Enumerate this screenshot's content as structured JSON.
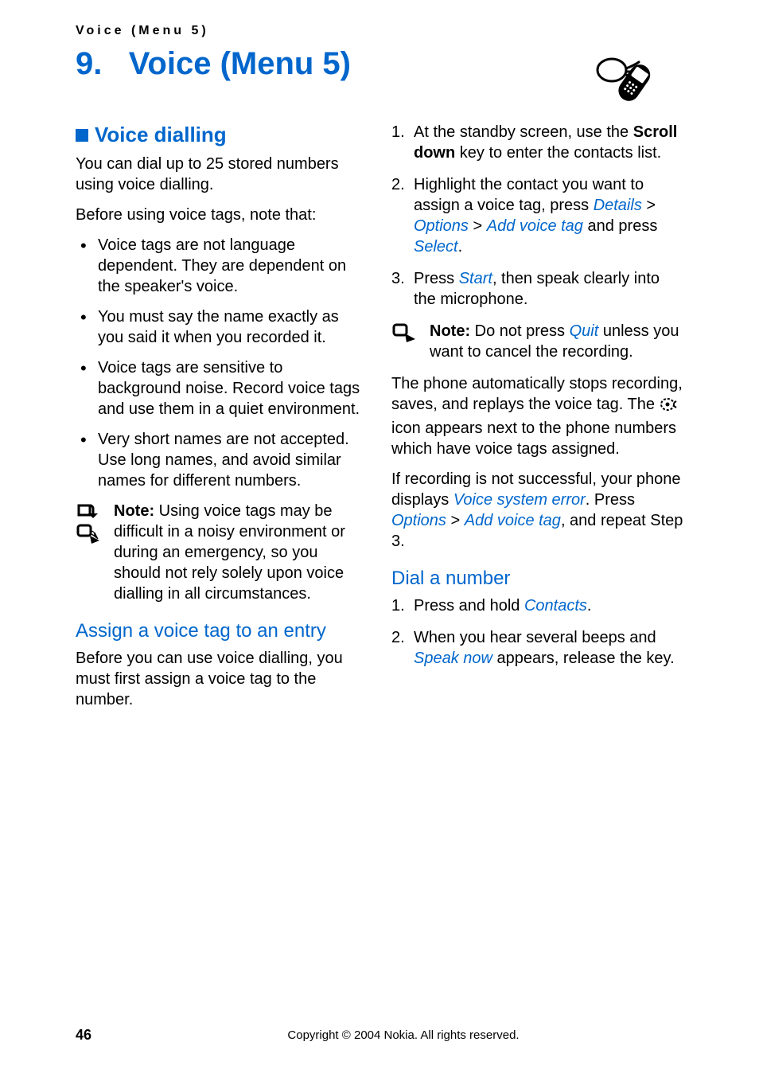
{
  "running_head": "Voice (Menu 5)",
  "chapter_number": "9.",
  "chapter_title": "Voice (Menu 5)",
  "left": {
    "section_title": "Voice dialling",
    "intro": "You can dial up to 25 stored numbers using voice dialling.",
    "before_using": "Before using voice tags, note that:",
    "bullets": [
      "Voice tags are not language dependent. They are dependent on the speaker's voice.",
      "You must say the name exactly as you said it when you recorded it.",
      "Voice tags are sensitive to background noise. Record voice tags and use them in a quiet environment.",
      "Very short names are not accepted. Use long names, and avoid similar names for different numbers."
    ],
    "note_label": "Note:",
    "note_body": " Using voice tags may be difficult in a noisy environment or during an emergency, so you should not rely solely upon voice dialling in all circumstances.",
    "assign_title": "Assign a voice tag to an entry",
    "assign_para": "Before you can use voice dialling, you must first assign a voice tag to the number."
  },
  "right": {
    "step1_a": "At the standby screen, use the ",
    "step1_b": "Scroll down",
    "step1_c": " key to enter the contacts list.",
    "step2_a": "Highlight the contact you want to assign a voice tag, press ",
    "step2_details": "Details",
    "step2_options": "Options",
    "step2_addvt": "Add voice tag",
    "step2_b": " and press ",
    "step2_select": "Select",
    "step3_a": "Press ",
    "step3_start": "Start",
    "step3_b": ", then speak clearly into the microphone.",
    "note_label": "Note:",
    "note_a": " Do not press ",
    "note_quit": "Quit",
    "note_b": " unless you want to cancel the recording.",
    "auto_a": "The phone automatically stops recording, saves, and replays the voice tag. The ",
    "auto_b": " icon appears next to the phone numbers which have voice tags assigned.",
    "fail_a": "If recording is not successful, your phone displays ",
    "fail_vse": "Voice system error",
    "fail_b": ". Press ",
    "fail_options": "Options",
    "fail_addvt": "Add voice tag",
    "fail_c": ", and repeat Step 3.",
    "dial_title": "Dial a number",
    "dial1_a": "Press and hold ",
    "dial1_contacts": "Contacts",
    "dial2_a": "When you hear several beeps and ",
    "dial2_speak": "Speak now",
    "dial2_b": " appears, release the key."
  },
  "footer": {
    "page": "46",
    "copyright": "Copyright © 2004 Nokia. All rights reserved."
  }
}
